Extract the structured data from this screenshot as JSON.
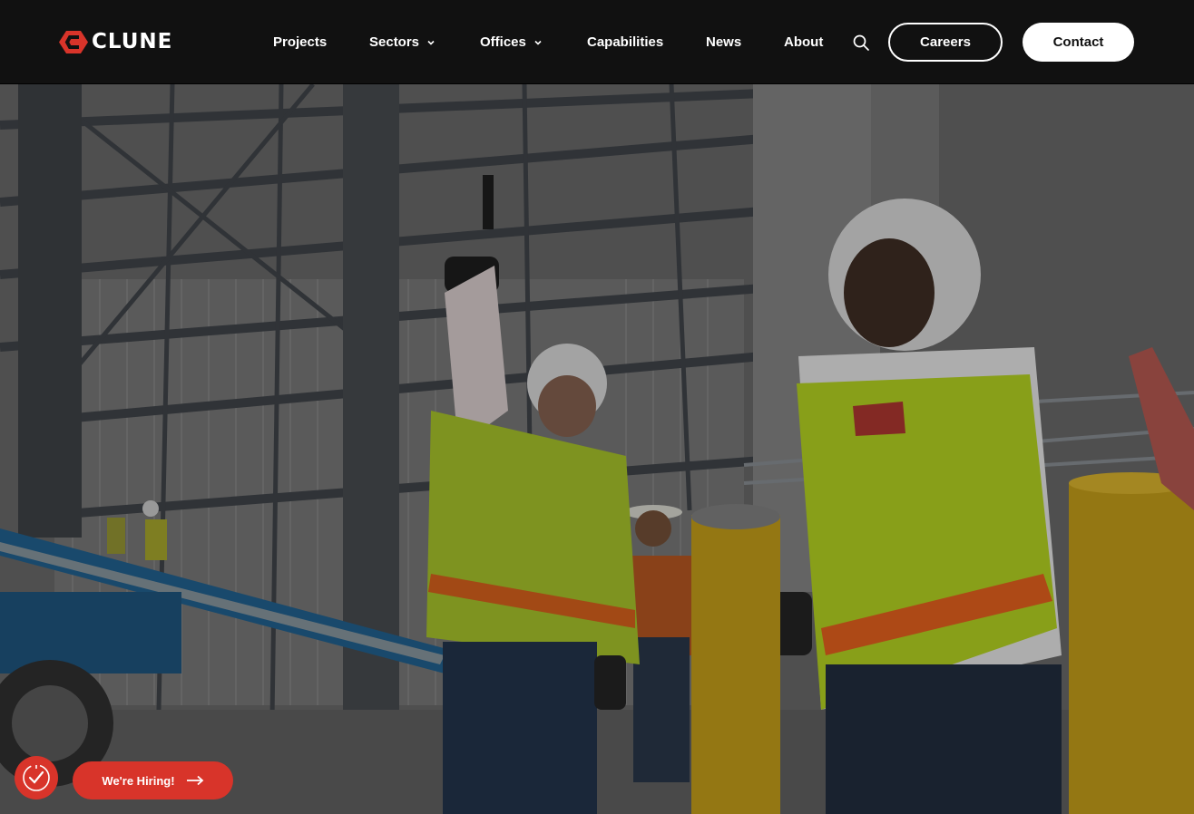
{
  "brand": {
    "name": "CLUNE",
    "accent": "#d8342a"
  },
  "nav": {
    "items": [
      {
        "label": "Projects",
        "has_dropdown": false
      },
      {
        "label": "Sectors",
        "has_dropdown": true
      },
      {
        "label": "Offices",
        "has_dropdown": true
      },
      {
        "label": "Capabilities",
        "has_dropdown": false
      },
      {
        "label": "News",
        "has_dropdown": false
      },
      {
        "label": "About",
        "has_dropdown": false
      }
    ],
    "search_icon": "search-icon",
    "careers_label": "Careers",
    "contact_label": "Contact"
  },
  "hero": {
    "image": "construction-workers-steel-frame-photo"
  },
  "hiring": {
    "label": "We're Hiring!",
    "badge_icon": "check-badge-icon",
    "arrow_icon": "arrow-right-icon"
  }
}
